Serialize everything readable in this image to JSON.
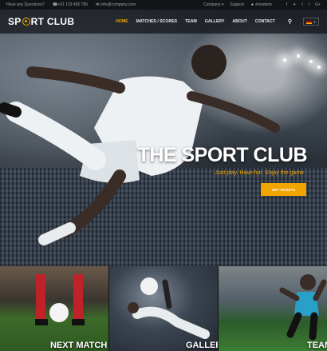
{
  "topbar": {
    "question": "Have any Questions?",
    "phone": "+01 123 456 789",
    "email": "info@company.com",
    "company_link": "Company",
    "support_link": "Support",
    "account": "#oneitem",
    "social": [
      "f",
      "✈",
      "t",
      "t",
      "G+"
    ]
  },
  "header": {
    "logo_left": "SP",
    "logo_right": "RT CLUB",
    "nav": [
      "HOME",
      "MATCHES / SCORES",
      "TEAM",
      "GALLERY",
      "ABOUT",
      "CONTACT"
    ],
    "active_nav": "HOME"
  },
  "hero": {
    "title": "THE SPORT CLUB",
    "subtitle": "Just play. Have fun. Enjoy the game.",
    "button": "GET TICKETS"
  },
  "tiles": [
    {
      "label": "NEXT MATCH"
    },
    {
      "label": "GALLERY"
    },
    {
      "label": "TEAM"
    }
  ],
  "colors": {
    "accent": "#f0a500",
    "header_bg": "#111418",
    "topbar_bg": "#121518"
  }
}
